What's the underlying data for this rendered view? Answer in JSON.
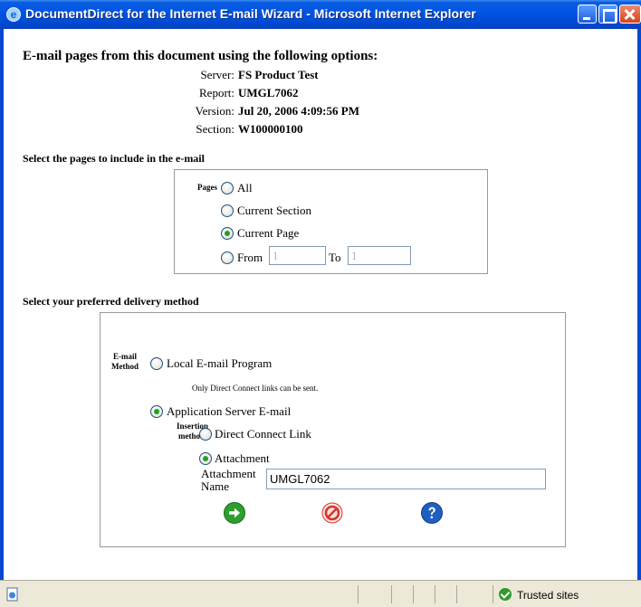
{
  "window": {
    "title": "DocumentDirect for the Internet E-mail Wizard - Microsoft Internet Explorer"
  },
  "header": {
    "heading": "E-mail pages from this document using the following options:",
    "info": [
      {
        "label": "Server:",
        "value": "FS Product Test"
      },
      {
        "label": "Report:",
        "value": "UMGL7062"
      },
      {
        "label": "Version:",
        "value": "Jul 20, 2006 4:09:56 PM"
      },
      {
        "label": "Section:",
        "value": "W100000100"
      }
    ]
  },
  "pages_section": {
    "title": "Select the pages to include in the e-mail",
    "group_label": "Pages",
    "options": {
      "all": "All",
      "current_section": "Current Section",
      "current_page": "Current Page",
      "from": "From",
      "to": "To"
    },
    "selected": "current_page",
    "from_value": "1",
    "to_value": "1"
  },
  "delivery_section": {
    "title": "Select your preferred delivery method",
    "method_label_1": "E-mail",
    "method_label_2": "Method",
    "local_program": "Local E-mail Program",
    "local_note": "Only Direct Connect links can be sent.",
    "app_server": "Application Server E-mail",
    "insertion_label_1": "Insertion",
    "insertion_label_2": "method",
    "direct_link": "Direct Connect Link",
    "attachment": "Attachment",
    "attachment_name_label_1": "Attachment",
    "attachment_name_label_2": "Name",
    "attachment_name_value": "UMGL7062",
    "selected_method": "app_server",
    "selected_insertion": "attachment"
  },
  "actions": {
    "ok_icon": "green-arrow-icon",
    "cancel_icon": "red-cancel-icon",
    "help_icon": "blue-help-icon"
  },
  "statusbar": {
    "zone_text": "Trusted sites"
  },
  "colors": {
    "titlebar": "#0055e5",
    "ok": "#2e9e2e",
    "cancel": "#d9342b",
    "help": "#1f5fbf"
  }
}
